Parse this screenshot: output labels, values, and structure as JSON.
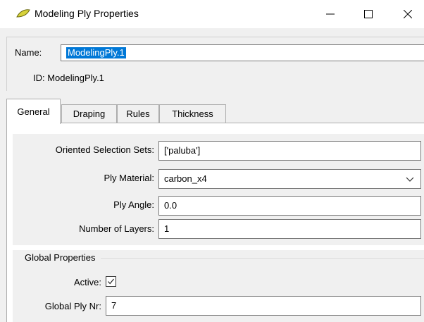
{
  "window": {
    "title": "Modeling Ply Properties",
    "icon": "leaf-icon",
    "controls": {
      "minimize": "—",
      "maximize": "☐",
      "close": "✕"
    }
  },
  "header": {
    "name_label": "Name:",
    "name_value": "ModelingPly.1",
    "id_text": "ID: ModelingPly.1"
  },
  "tabs": [
    {
      "label": "General",
      "active": true
    },
    {
      "label": "Draping",
      "active": false
    },
    {
      "label": "Rules",
      "active": false
    },
    {
      "label": "Thickness",
      "active": false
    }
  ],
  "general": {
    "oriented_selection_sets": {
      "label": "Oriented Selection Sets:",
      "value": "['paluba']"
    },
    "ply_material": {
      "label": "Ply Material:",
      "value": "carbon_x4"
    },
    "ply_angle": {
      "label": "Ply Angle:",
      "value": "0.0"
    },
    "number_of_layers": {
      "label": "Number of Layers:",
      "value": "1"
    }
  },
  "global_properties": {
    "title": "Global Properties",
    "active": {
      "label": "Active:",
      "checked": true
    },
    "global_ply_nr": {
      "label": "Global Ply Nr:",
      "value": "7"
    }
  },
  "colors": {
    "selection": "#0078d7",
    "window_bg": "#f0f0f0",
    "icon_yellow": "#d7d23a"
  }
}
